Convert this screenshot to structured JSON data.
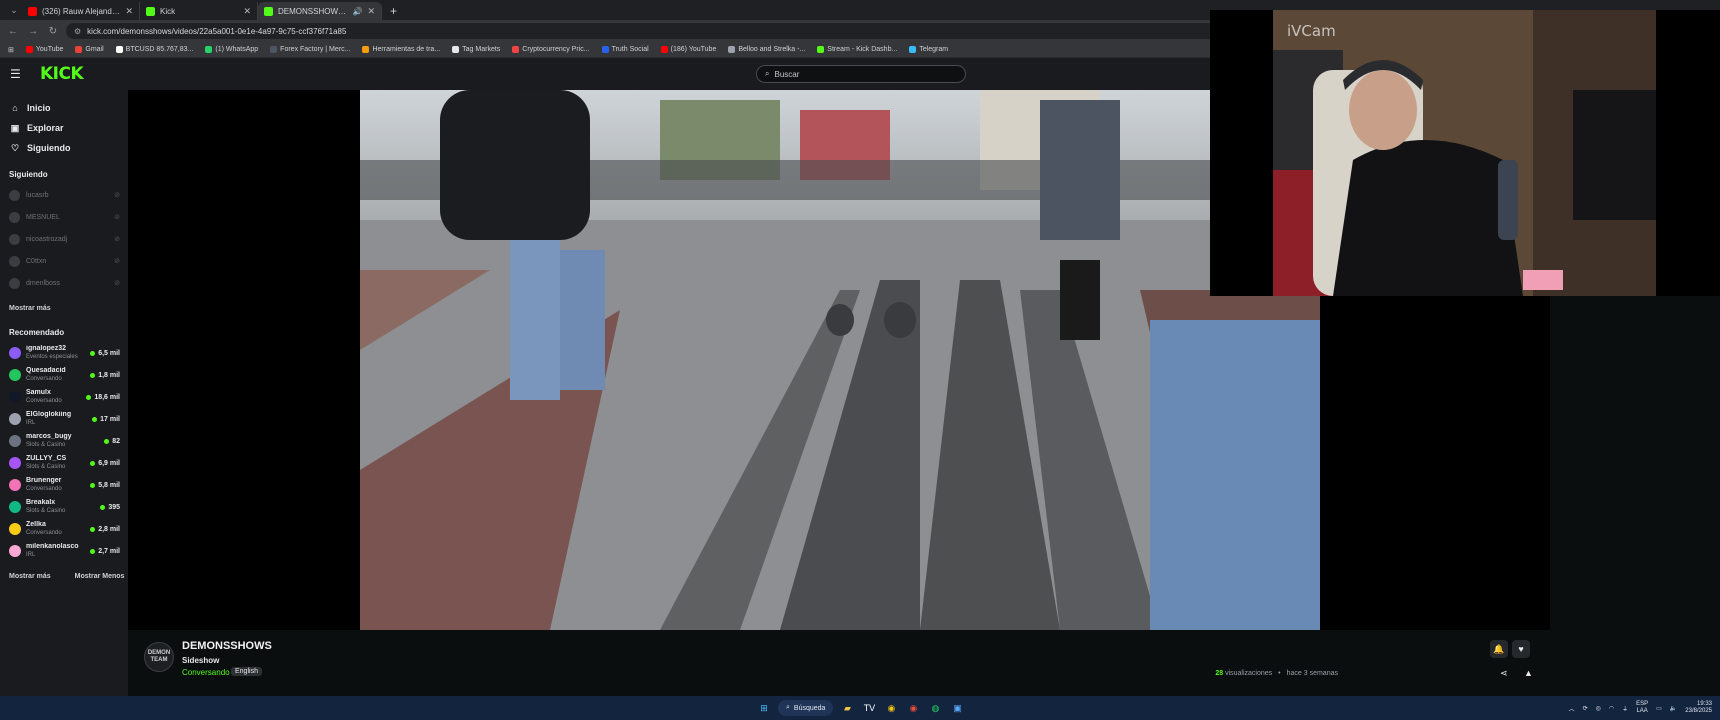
{
  "browser": {
    "tabs": [
      {
        "title": "(326) Rauw Alejandro, Marcos",
        "favicon_color": "#ff0000",
        "active": false
      },
      {
        "title": "Kick",
        "favicon_color": "#53fc18",
        "active": false
      },
      {
        "title": "DEMONSSHOWS - Watch",
        "favicon_color": "#53fc18",
        "active": true
      }
    ],
    "url": "kick.com/demonsshows/videos/22a5a001-0e1e-4a97-9c75-ccf376f71a85",
    "bookmarks": [
      {
        "label": "YouTube",
        "color": "#ff0000"
      },
      {
        "label": "Gmail",
        "color": "#ea4335"
      },
      {
        "label": "BTCUSD 85.767,83...",
        "color": "#ffffff"
      },
      {
        "label": "(1) WhatsApp",
        "color": "#25d366"
      },
      {
        "label": "Forex Factory | Merc...",
        "color": "#4b5563"
      },
      {
        "label": "Herramientas de tra...",
        "color": "#f59e0b"
      },
      {
        "label": "Tag Markets",
        "color": "#e5e7eb"
      },
      {
        "label": "Cryptocurrency Pric...",
        "color": "#ef4444"
      },
      {
        "label": "Truth Social",
        "color": "#2563eb"
      },
      {
        "label": "(186) YouTube",
        "color": "#ff0000"
      },
      {
        "label": "Belloo and Strelka -...",
        "color": "#9ca3af"
      },
      {
        "label": "Stream - Kick Dashb...",
        "color": "#53fc18"
      },
      {
        "label": "Telegram",
        "color": "#38bdf8"
      }
    ]
  },
  "header": {
    "logo": "KICK",
    "search_placeholder": "Buscar"
  },
  "sidebar": {
    "nav": [
      {
        "label": "Inicio",
        "icon": "home-icon"
      },
      {
        "label": "Explorar",
        "icon": "compass-icon"
      },
      {
        "label": "Siguiendo",
        "icon": "heart-icon"
      }
    ],
    "following_header": "Siguiendo",
    "following": [
      {
        "name": "lucasrb"
      },
      {
        "name": "MESNUEL"
      },
      {
        "name": "nicoastrozadj"
      },
      {
        "name": "C0ttxn"
      },
      {
        "name": "dmenlboss"
      }
    ],
    "show_more": "Mostrar más",
    "recommended_header": "Recomendado",
    "recommended": [
      {
        "name": "ignalopez32",
        "category": "Eventos especiales",
        "viewers": "6,5 mil",
        "color": "#8b5cf6"
      },
      {
        "name": "Quesadacid",
        "category": "Conversando",
        "viewers": "1,8 mil",
        "color": "#22c55e"
      },
      {
        "name": "Samulx",
        "category": "Conversando",
        "viewers": "18,6 mil",
        "color": "#111827"
      },
      {
        "name": "ElGloglokiing",
        "category": "IRL",
        "viewers": "17 mil",
        "color": "#9ca3af"
      },
      {
        "name": "marcos_bugy",
        "category": "Slots & Casino",
        "viewers": "82",
        "color": "#6b7280"
      },
      {
        "name": "ZULLYY_CS",
        "category": "Slots & Casino",
        "viewers": "6,9 mil",
        "color": "#a855f7"
      },
      {
        "name": "Brunenger",
        "category": "Conversando",
        "viewers": "5,8 mil",
        "color": "#f472b6"
      },
      {
        "name": "Breakalx",
        "category": "Slots & Casino",
        "viewers": "395",
        "color": "#10b981"
      },
      {
        "name": "Zellka",
        "category": "Conversando",
        "viewers": "2,8 mil",
        "color": "#facc15"
      },
      {
        "name": "milenkanolasco",
        "category": "IRL",
        "viewers": "2,7 mil",
        "color": "#f9a8d4"
      }
    ],
    "footer_more": "Mostrar más",
    "footer_less": "Mostrar Menos"
  },
  "webcam": {
    "watermark": "iVCam"
  },
  "channel": {
    "avatar_text": "DEMON TEAM",
    "name": "DEMONSSHOWS",
    "video_title": "Sideshow",
    "category": "Conversando",
    "language": "English",
    "views_count": "28",
    "views_label": "visualizaciones",
    "separator": "•",
    "posted": "hace 3 semanas"
  },
  "taskbar": {
    "search_label": "Búsqueda",
    "language_top": "ESP",
    "language_bottom": "LAA",
    "time": "19:33",
    "date": "23/8/2025"
  }
}
